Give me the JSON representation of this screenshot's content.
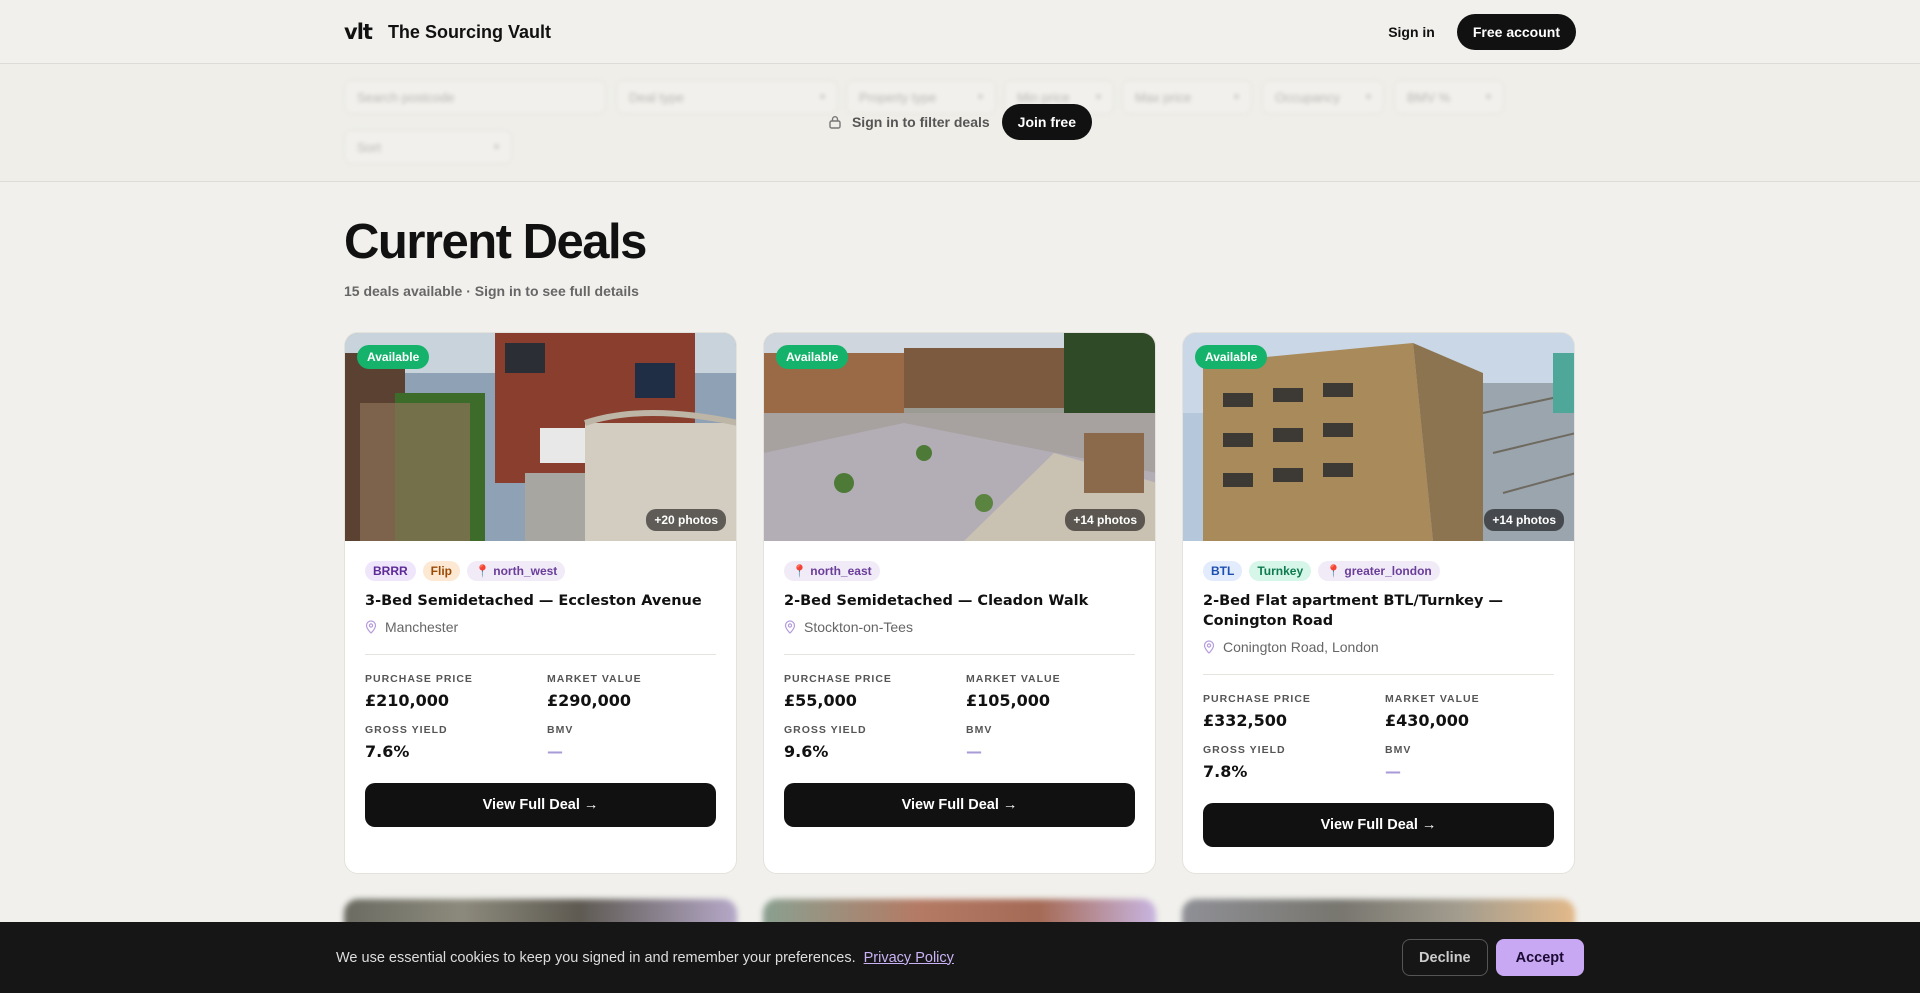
{
  "header": {
    "logo": "vlt",
    "brand": "The Sourcing Vault",
    "signin": "Sign in",
    "cta": "Free account"
  },
  "filters": {
    "search_placeholder": "Search postcode",
    "deal_type": "Deal type",
    "property_type": "Property type",
    "min_price": "Min price",
    "max_price": "Max price",
    "occupancy": "Occupancy",
    "bmv": "BMV %",
    "sort": "Sort",
    "lock_text": "Sign in to filter deals",
    "join": "Join free"
  },
  "main": {
    "title": "Current Deals",
    "subtitle": "15 deals available · Sign in to see full details"
  },
  "labels": {
    "available": "Available",
    "purchase_price": "PURCHASE PRICE",
    "market_value": "MARKET VALUE",
    "gross_yield": "GROSS YIELD",
    "bmv": "BMV",
    "view": "View Full Deal →"
  },
  "deals": [
    {
      "photos": "+20 photos",
      "tags": [
        "BRRR",
        "Flip",
        "📍 north_west"
      ],
      "title": "3-Bed Semidetached — Eccleston Avenue",
      "location": "Manchester",
      "purchase_price": "£210,000",
      "market_value": "£290,000",
      "gross_yield": "7.6%",
      "bmv": "—"
    },
    {
      "photos": "+14 photos",
      "tags": [
        "📍 north_east"
      ],
      "title": "2-Bed Semidetached — Cleadon Walk",
      "location": "Stockton-on-Tees",
      "purchase_price": "£55,000",
      "market_value": "£105,000",
      "gross_yield": "9.6%",
      "bmv": "—"
    },
    {
      "photos": "+14 photos",
      "tags": [
        "BTL",
        "Turnkey",
        "📍 greater_london"
      ],
      "title": "2-Bed Flat apartment BTL/Turnkey — Conington Road",
      "location": "Conington Road, London",
      "purchase_price": "£332,500",
      "market_value": "£430,000",
      "gross_yield": "7.8%",
      "bmv": "—"
    }
  ],
  "cookie": {
    "text": "We use essential cookies to keep you signed in and remember your preferences.",
    "link": "Privacy Policy",
    "decline": "Decline",
    "accept": "Accept"
  },
  "colors": {
    "accent_green": "#15b26b",
    "accent_purple": "#c9a8f3",
    "dark": "#111111"
  }
}
